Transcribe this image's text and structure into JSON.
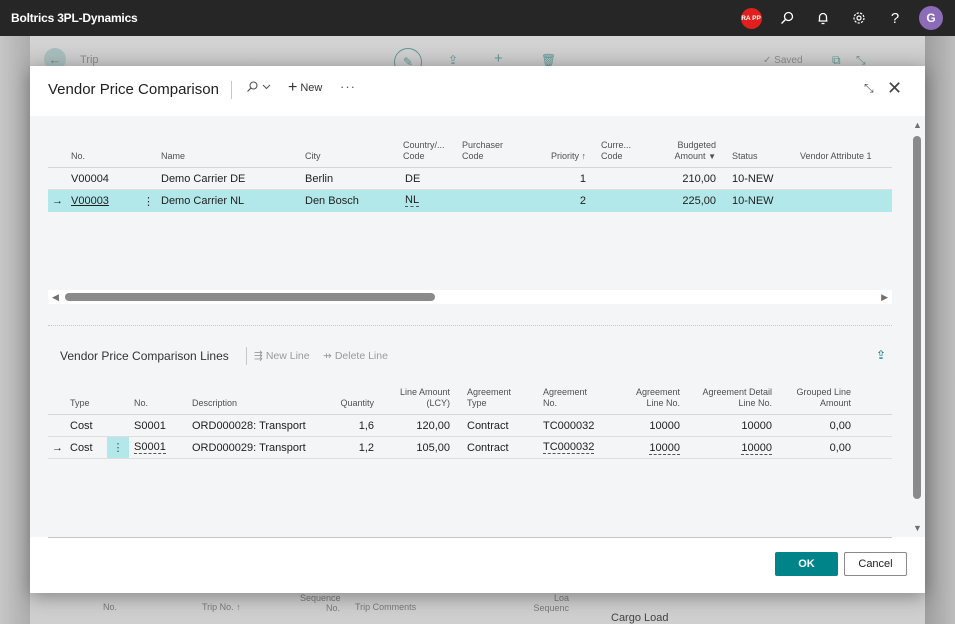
{
  "app": {
    "title": "Boltrics 3PL-Dynamics",
    "badge": "RA PP",
    "avatar_initial": "G",
    "icons": [
      "search-icon",
      "bell-icon",
      "gear-icon",
      "help-icon"
    ]
  },
  "background_page": {
    "title": "Trip",
    "saved_label": "✓ Saved",
    "columns": [
      "No.",
      "Trip No. ↑",
      "Sequence No.",
      "Trip Comments",
      "Loa Sequenc"
    ],
    "side_label": "Cargo Load"
  },
  "dialog": {
    "title": "Vendor Price Comparison",
    "new_label": "New",
    "more_label": "···",
    "header_table": {
      "columns": [
        {
          "label": "No."
        },
        {
          "label": "Name"
        },
        {
          "label": "City"
        },
        {
          "label": "Country/... Code"
        },
        {
          "label": "Purchaser Code"
        },
        {
          "label": "Priority ↑"
        },
        {
          "label": "Curre... Code"
        },
        {
          "label": "Budgeted Amount"
        },
        {
          "label": "Status"
        },
        {
          "label": "Vendor Attribute 1"
        }
      ],
      "rows": [
        {
          "no": "V00004",
          "name": "Demo Carrier DE",
          "city": "Berlin",
          "country": "DE",
          "purchaser": "",
          "priority": "1",
          "currency": "",
          "budgeted": "210,00",
          "status": "10-NEW",
          "attr1": "",
          "selected": false
        },
        {
          "no": "V00003",
          "name": "Demo Carrier NL",
          "city": "Den Bosch",
          "country": "NL",
          "purchaser": "",
          "priority": "2",
          "currency": "",
          "budgeted": "225,00",
          "status": "10-NEW",
          "attr1": "",
          "selected": true
        }
      ]
    },
    "lines": {
      "title": "Vendor Price Comparison Lines",
      "new_line_label": "New Line",
      "delete_line_label": "Delete Line",
      "columns": [
        {
          "label": "Type"
        },
        {
          "label": "No."
        },
        {
          "label": "Description"
        },
        {
          "label": "Quantity"
        },
        {
          "label": "Line Amount (LCY)"
        },
        {
          "label": "Agreement Type"
        },
        {
          "label": "Agreement No."
        },
        {
          "label": "Agreement Line No."
        },
        {
          "label": "Agreement Detail Line No."
        },
        {
          "label": "Grouped Line Amount"
        }
      ],
      "rows": [
        {
          "type": "Cost",
          "no": "S0001",
          "description": "ORD000028: Transport",
          "quantity": "1,6",
          "line_amount": "120,00",
          "agreement_type": "Contract",
          "agreement_no": "TC000032",
          "agreement_line_no": "10000",
          "agreement_detail_line_no": "10000",
          "grouped_line_amount": "0,00",
          "selected": false
        },
        {
          "type": "Cost",
          "no": "S0001",
          "description": "ORD000029: Transport",
          "quantity": "1,2",
          "line_amount": "105,00",
          "agreement_type": "Contract",
          "agreement_no": "TC000032",
          "agreement_line_no": "10000",
          "agreement_detail_line_no": "10000",
          "grouped_line_amount": "0,00",
          "selected": true
        }
      ]
    },
    "ok_label": "OK",
    "cancel_label": "Cancel"
  },
  "colors": {
    "accent": "#008489",
    "selected_row": "#b2e8ea",
    "topbar": "#262626",
    "badge": "#e0201c",
    "avatar": "#8c6bb8"
  }
}
